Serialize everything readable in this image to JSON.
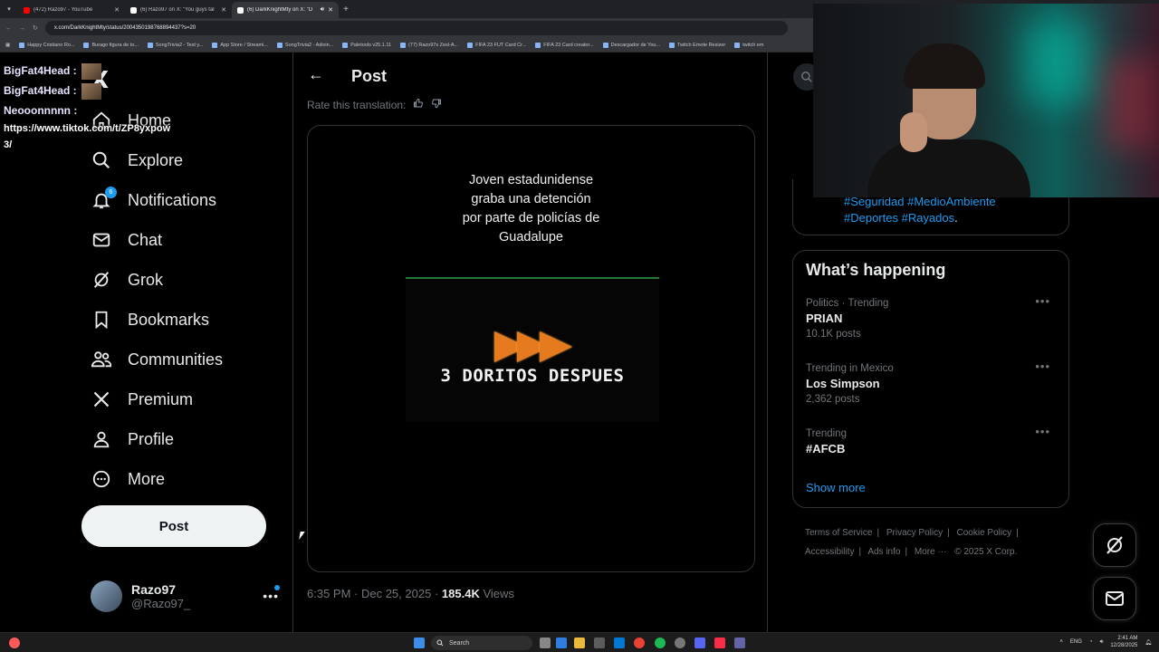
{
  "browser": {
    "tabs": [
      {
        "title": "(472) Razo97 - YouTube",
        "color": "#ff0000",
        "active": false
      },
      {
        "title": "(6) Razo97 on X: \"You guys tal",
        "color": "#ffffff",
        "active": false
      },
      {
        "title": "(6) DarkKnightMty on X: \"D",
        "color": "#ffffff",
        "active": true
      }
    ],
    "url": "x.com/DarkKnightMty/status/2004350198768894437?s=20",
    "bookmarks": [
      "Happy Cristiano Ro...",
      "Burago figura de to...",
      "SongTrivia2 - Test y...",
      "App Store / Streami...",
      "SongTrivia2 - Adivin...",
      "Paletools v25.1.11",
      "(77) Razo97s Zesl-A...",
      "FIFA 23 FUT Card Cr...",
      "FIFA 23 Card creator...",
      "Descargador de You...",
      "Twitch Emote Resizer",
      "twitch em"
    ]
  },
  "chat": {
    "lines": [
      {
        "user": "BigFat4Head :"
      },
      {
        "user": "BigFat4Head :"
      },
      {
        "user": "Neooonnnnn :",
        "message": "https://www.tiktok.com/t/ZP8yxpow3/"
      }
    ],
    "message_line1": "https://www.tiktok.com/t/ZP8yxpow",
    "message_line2": "3/"
  },
  "sidebar": {
    "logo": "X",
    "items": [
      {
        "label": "Home",
        "icon": "home-icon"
      },
      {
        "label": "Explore",
        "icon": "search-icon"
      },
      {
        "label": "Notifications",
        "icon": "bell-icon",
        "badge": "6"
      },
      {
        "label": "Chat",
        "icon": "mail-icon"
      },
      {
        "label": "Grok",
        "icon": "grok-icon"
      },
      {
        "label": "Bookmarks",
        "icon": "bookmark-icon"
      },
      {
        "label": "Communities",
        "icon": "communities-icon"
      },
      {
        "label": "Premium",
        "icon": "x-premium-icon"
      },
      {
        "label": "Profile",
        "icon": "person-icon"
      },
      {
        "label": "More",
        "icon": "more-circle-icon"
      }
    ],
    "post_button": "Post",
    "account": {
      "name": "Razo97",
      "handle": "@Razo97_"
    }
  },
  "main": {
    "title": "Post",
    "rate_translation": "Rate this translation:",
    "media": {
      "caption_lines": [
        "Joven estadunidense",
        "graba una detención",
        "por parte de policías de",
        "Guadalupe"
      ],
      "video_text": "3 DORITOS DESPUES"
    },
    "meta": {
      "time": "6:35 PM · Dec 25, 2025",
      "separator": "·",
      "views_count": "185.4K",
      "views_label": "Views"
    }
  },
  "right": {
    "top_card": {
      "tags_line1": "#Seguridad #MedioAmbiente",
      "tags_line2": "#Deportes #Rayados",
      "period": "."
    },
    "happening": {
      "title": "What’s happening",
      "trends": [
        {
          "meta": "Politics · Trending",
          "name": "PRIAN",
          "posts": "10.1K posts"
        },
        {
          "meta": "Trending in Mexico",
          "name": "Los Simpson",
          "posts": "2,362 posts"
        },
        {
          "meta": "Trending",
          "name": "#AFCB",
          "posts": ""
        }
      ],
      "show_more": "Show more"
    },
    "footer": {
      "terms": "Terms of Service",
      "privacy": "Privacy Policy",
      "cookie": "Cookie Policy",
      "accessibility": "Accessibility",
      "ads": "Ads info",
      "more": "More ···",
      "copyright": "© 2025 X Corp."
    }
  },
  "taskbar": {
    "search": "Search",
    "lang": "ENG",
    "time": "2:41 AM",
    "date": "12/28/2025"
  },
  "colors": {
    "accent": "#1d9bf0",
    "background": "#000000",
    "border": "#2f3336",
    "muted": "#71767b"
  }
}
